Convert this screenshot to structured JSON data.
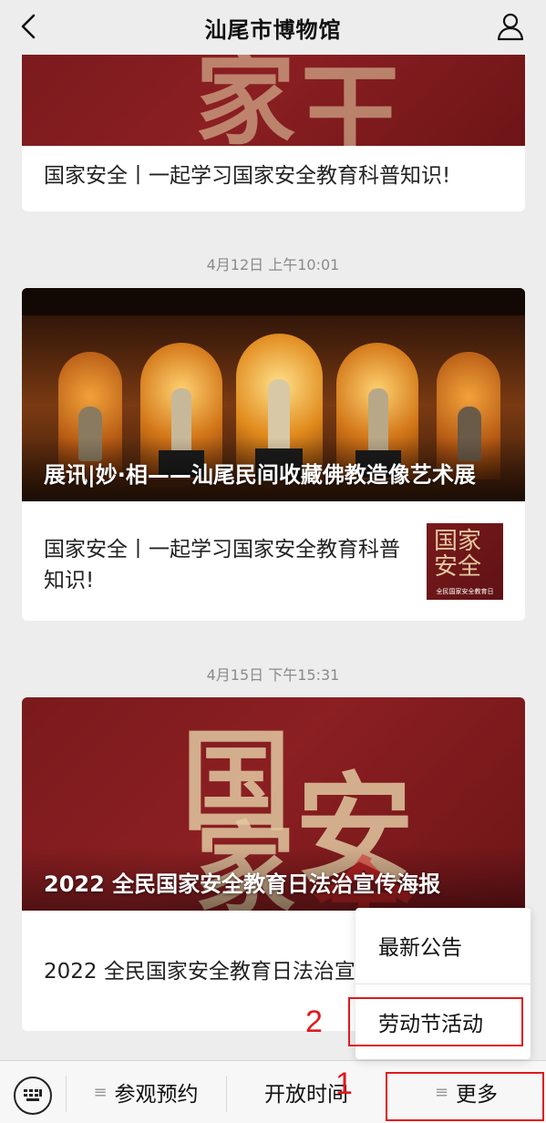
{
  "header": {
    "title": "汕尾市博物馆",
    "back_icon": "chevron-left-icon",
    "profile_icon": "user-icon"
  },
  "messages": {
    "card1": {
      "text": "国家安全丨一起学习国家安全教育科普知识!"
    },
    "time2": "4月12日 上午10:01",
    "card2": {
      "cover_title": "展讯|妙·相——汕尾民间收藏佛教造像艺术展",
      "sub_text": "国家安全丨一起学习国家安全教育科普知识!",
      "thumb_chars": "国家安全",
      "thumb_caption": "全民国家安全教育日"
    },
    "time3": "4月15日 下午15:31",
    "card3": {
      "cover_title": "2022 全民国家安全教育日法治宣传海报",
      "sub_text": "2022 全民国家安全教育日法治宣传海报"
    }
  },
  "bottom_menu": {
    "keyboard_icon": "keyboard-icon",
    "item1": "参观预约",
    "item2": "开放时间",
    "item3": "更多"
  },
  "popup": {
    "item1": "最新公告",
    "item2": "劳动节活动"
  },
  "annotations": {
    "label1": "1",
    "label2": "2",
    "color": "#e0191d"
  }
}
